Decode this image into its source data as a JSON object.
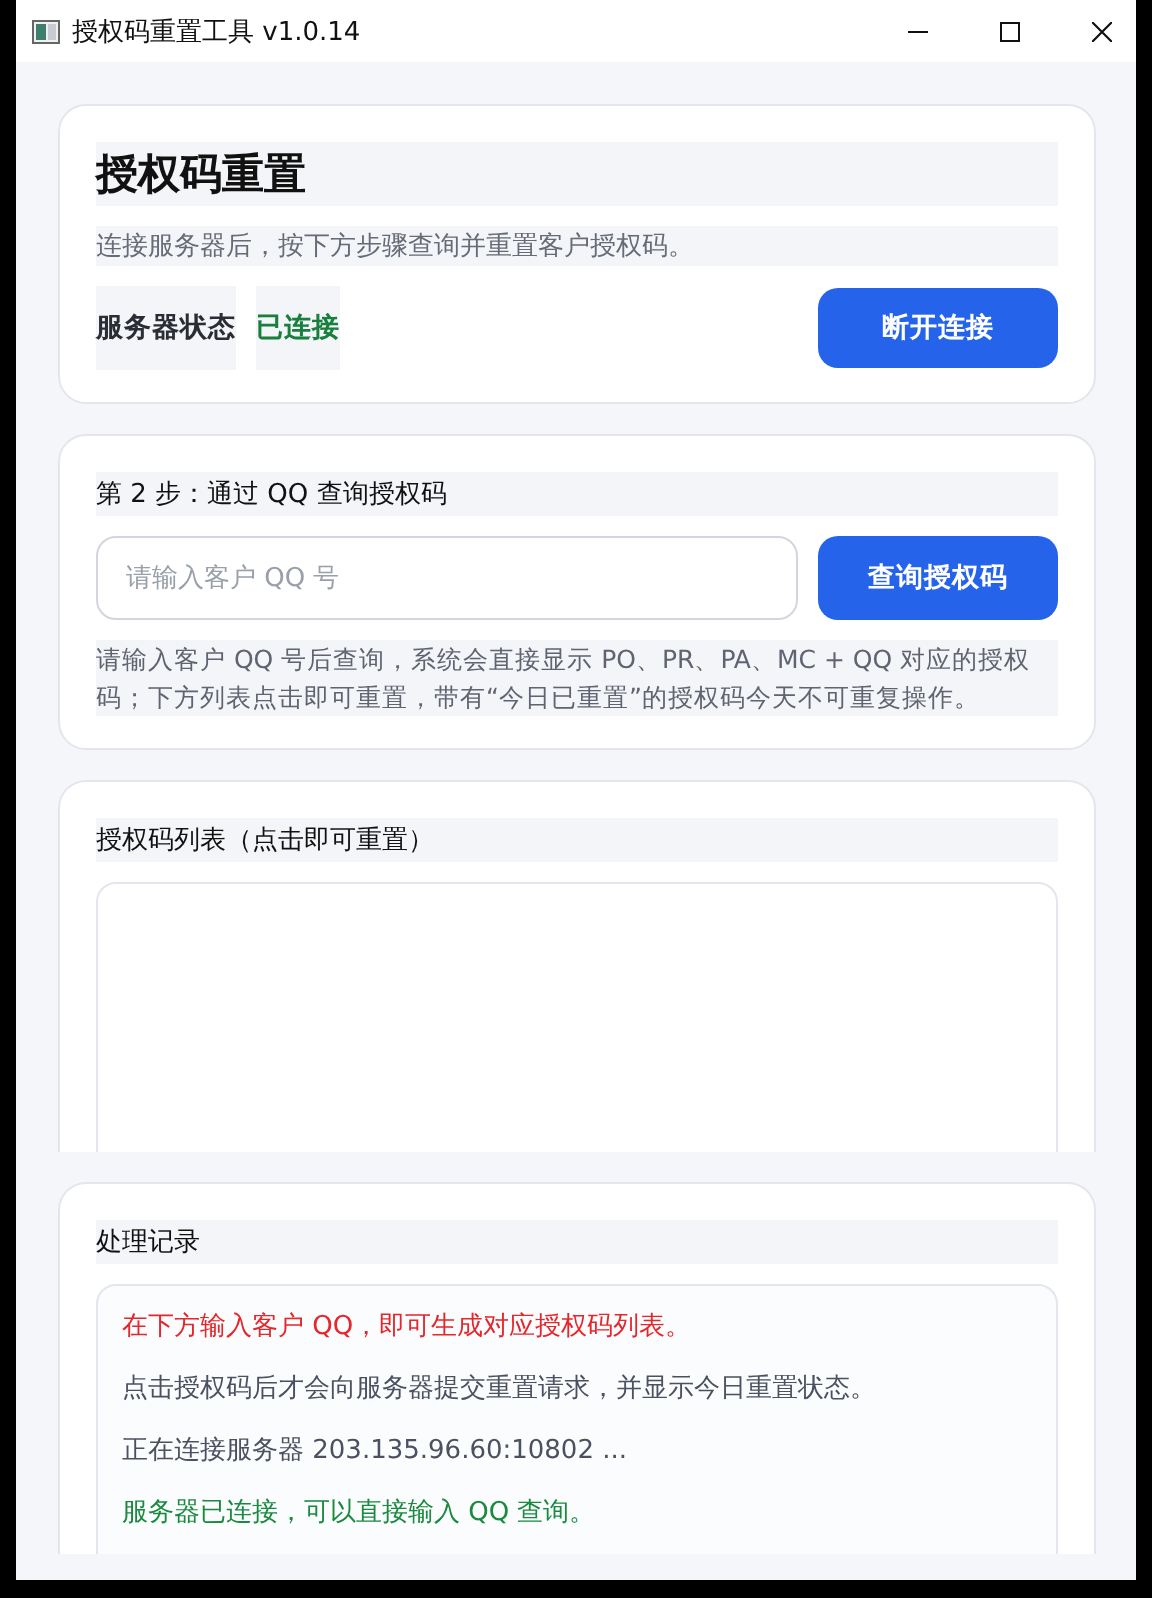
{
  "window": {
    "title": "授权码重置工具 v1.0.14"
  },
  "header": {
    "title": "授权码重置",
    "subtitle": "连接服务器后，按下方步骤查询并重置客户授权码。",
    "status_label": "服务器状态",
    "status_value": "已连接",
    "connected": true,
    "button": "断开连接"
  },
  "query": {
    "heading": "第 2 步：通过 QQ 查询授权码",
    "placeholder": "请输入客户 QQ 号",
    "button": "查询授权码",
    "hint": "请输入客户 QQ 号后查询，系统会直接显示 PO、PR、PA、MC + QQ 对应的授权码；下方列表点击即可重置，带有“今日已重置”的授权码今天不可重复操作。"
  },
  "code_list": {
    "heading": "授权码列表（点击即可重置）"
  },
  "log": {
    "heading": "处理记录",
    "entries": [
      {
        "text": "在下方输入客户 QQ，即可生成对应授权码列表。",
        "color": "#e5262a"
      },
      {
        "text": "点击授权码后才会向服务器提交重置请求，并显示今日重置状态。",
        "color": "#4b5160"
      },
      {
        "text": "正在连接服务器 203.135.96.60:10802 ...",
        "color": "#4b5160"
      },
      {
        "text": "服务器已连接，可以直接输入 QQ 查询。",
        "color": "#1a8a3f"
      }
    ]
  }
}
